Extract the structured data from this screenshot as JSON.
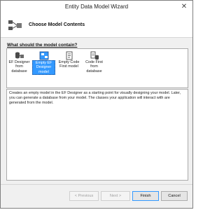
{
  "window": {
    "title": "Entity Data Model Wizard",
    "close_glyph": "✕"
  },
  "header": {
    "title": "Choose Model Contents"
  },
  "question": "What should the model contain?",
  "options": [
    {
      "label": "EF Designer from database",
      "icon": "database-model-icon",
      "selected": false
    },
    {
      "label": "Empty EF Designer model",
      "icon": "empty-model-icon",
      "selected": true
    },
    {
      "label": "Empty Code First model",
      "icon": "code-first-icon",
      "selected": false
    },
    {
      "label": "Code First from database",
      "icon": "code-first-db-icon",
      "selected": false
    }
  ],
  "description": "Creates an empty model in the EF Designer as a starting point for visually designing your model. Later, you can generate a database from your model. The classes your application will interact with are generated from the model.",
  "buttons": {
    "previous": "< Previous",
    "next": "Next >",
    "finish": "Finish",
    "cancel": "Cancel"
  },
  "colors": {
    "selection": "#3399ff",
    "background": "#f0f0f0"
  }
}
